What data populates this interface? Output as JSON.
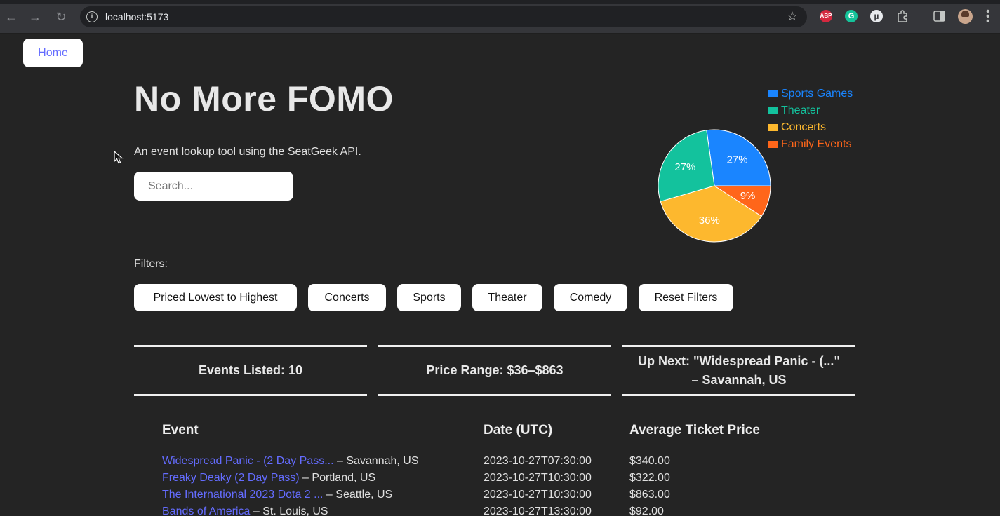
{
  "browser": {
    "url": "localhost:5173",
    "extensions": [
      "ABP",
      "G",
      "µ"
    ]
  },
  "nav": {
    "home_label": "Home"
  },
  "header": {
    "title": "No More FOMO",
    "subtitle": "An event lookup tool using the SeatGeek API."
  },
  "search": {
    "placeholder": "Search...",
    "value": ""
  },
  "filters": {
    "label": "Filters:",
    "buttons": [
      "Priced Lowest to Highest",
      "Concerts",
      "Sports",
      "Theater",
      "Comedy",
      "Reset Filters"
    ]
  },
  "stats": {
    "events_listed": "Events Listed: 10",
    "price_range": "Price Range: $36–$863",
    "up_next_line1": "Up Next: \"Widespread Panic - (...\"",
    "up_next_line2": "– Savannah, US"
  },
  "table": {
    "headers": [
      "Event",
      "Date (UTC)",
      "Average Ticket Price"
    ],
    "rows": [
      {
        "event": "Widespread Panic - (2 Day Pass...",
        "location": " – Savannah, US",
        "date": "2023-10-27T07:30:00",
        "price": "$340.00"
      },
      {
        "event": "Freaky Deaky (2 Day Pass)",
        "location": " – Portland, US",
        "date": "2023-10-27T10:30:00",
        "price": "$322.00"
      },
      {
        "event": "The International 2023 Dota 2 ...",
        "location": " – Seattle, US",
        "date": "2023-10-27T10:30:00",
        "price": "$863.00"
      },
      {
        "event": "Bands of America",
        "location": " – St. Louis, US",
        "date": "2023-10-27T13:30:00",
        "price": "$92.00"
      }
    ]
  },
  "chart_data": {
    "type": "pie",
    "categories": [
      "Sports Games",
      "Theater",
      "Concerts",
      "Family Events"
    ],
    "values": [
      27,
      27,
      36,
      9
    ],
    "labels": [
      "27%",
      "27%",
      "36%",
      "9%"
    ],
    "colors": [
      "#1a85ff",
      "#13c29d",
      "#fdb82e",
      "#ff661a"
    ],
    "legend": "top-right"
  }
}
